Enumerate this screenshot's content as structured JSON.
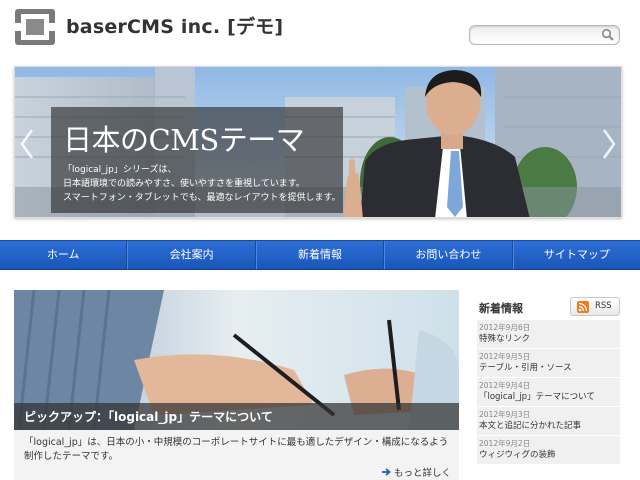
{
  "header": {
    "site_title": "baserCMS inc. [デモ]",
    "search": {
      "value": "",
      "placeholder": ""
    }
  },
  "hero": {
    "title": "日本のCMSテーマ",
    "text_lines": [
      "「logical_jp」シリーズは、",
      "日本語環境での読みやすさ、使いやすさを重視しています。",
      "スマートフォン・タブレットでも、最適なレイアウトを提供します。"
    ]
  },
  "nav": {
    "items": [
      "ホーム",
      "会社案内",
      "新着情報",
      "お問い合わせ",
      "サイトマップ"
    ]
  },
  "pickup": {
    "title": "ピックアップ：「logical_jp」テーマについて",
    "description": "「logical_jp」は、日本の小・中規模のコーポレートサイトに最も適したデザイン・構成になるよう制作したテーマです。",
    "more_label": "もっと詳しく"
  },
  "news": {
    "heading": "新着情報",
    "rss_label": "RSS",
    "items": [
      {
        "date": "2012年9月6日",
        "title": "特殊なリンク"
      },
      {
        "date": "2012年9月5日",
        "title": "テーブル・引用・ソース"
      },
      {
        "date": "2012年9月4日",
        "title": "「logical_jp」テーマについて"
      },
      {
        "date": "2012年9月3日",
        "title": "本文と追記に分かれた記事"
      },
      {
        "date": "2012年9月2日",
        "title": "ウィジウィグの装飾"
      }
    ]
  },
  "colors": {
    "nav_blue": "#1e5fc8",
    "rss_orange": "#f07c1e"
  }
}
